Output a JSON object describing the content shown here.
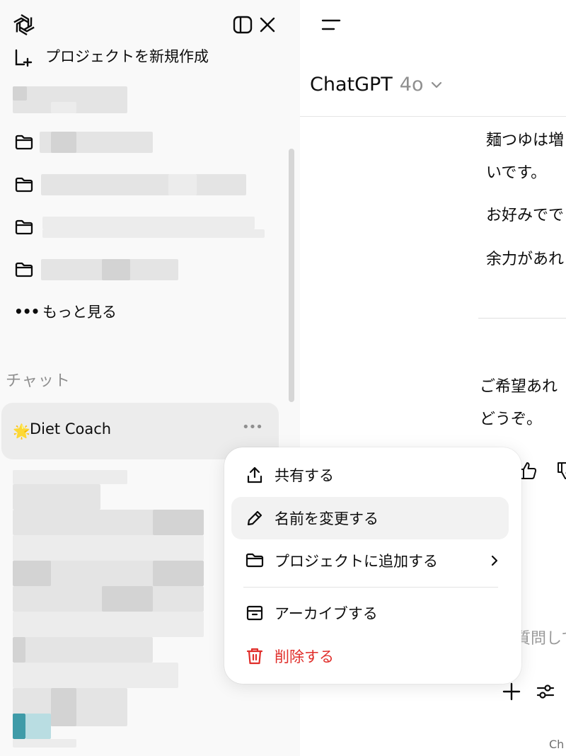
{
  "colors": {
    "danger": "#e02e2a",
    "sidebar_bg": "#f9f9f9",
    "active_bg": "#ececec",
    "accent_teal": "#4aa8b4"
  },
  "sidebar": {
    "logo_icon": "openai-logo-icon",
    "toggle_icon": "sidebar-toggle-icon",
    "close_icon": "close-icon",
    "new_project_label": "プロジェクトを新規作成",
    "more_label": "もっと見る",
    "section_chats": "チャット",
    "active_chat": {
      "emoji": "🌟",
      "title": "Diet Coach",
      "menu_icon": "ellipsis-icon"
    }
  },
  "main": {
    "menu_icon": "menu-icon",
    "model_name": "ChatGPT",
    "model_version": "4o",
    "messages": [
      "麺つゆは増",
      "いです。",
      "お好みでで",
      "余力があれ",
      "ご希望あれ",
      "どうぞ。"
    ],
    "input_placeholder": "質問して",
    "footer": "Ch"
  },
  "context_menu": {
    "items": [
      {
        "label": "共有する",
        "icon": "share-icon"
      },
      {
        "label": "名前を変更する",
        "icon": "pencil-icon"
      },
      {
        "label": "プロジェクトに追加する",
        "icon": "folder-icon"
      },
      {
        "label": "アーカイブする",
        "icon": "archive-icon"
      },
      {
        "label": "削除する",
        "icon": "trash-icon"
      }
    ]
  }
}
